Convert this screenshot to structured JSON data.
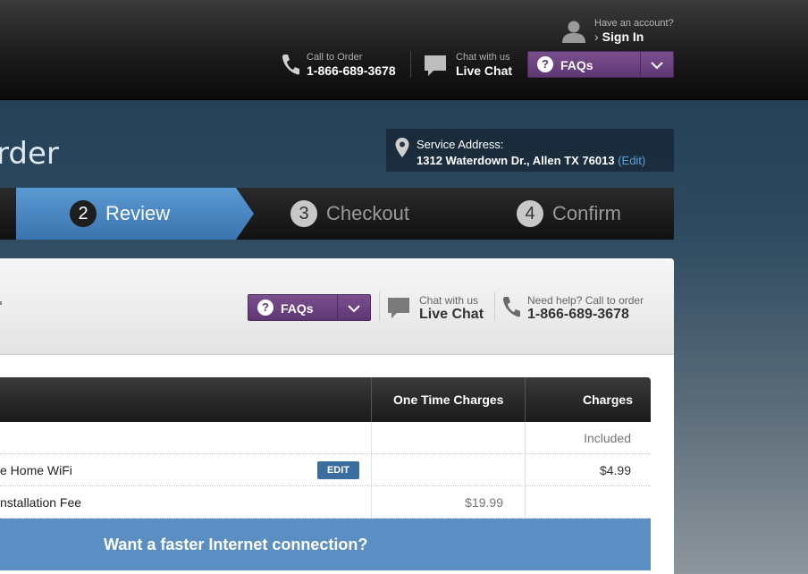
{
  "header": {
    "account": {
      "prompt": "Have an account?",
      "sign_in": "Sign In",
      "icon": "user-silhouette-icon"
    },
    "call": {
      "label": "Call to Order",
      "number": "1-866-689-3678",
      "icon": "phone-icon"
    },
    "chat": {
      "label": "Chat with us",
      "action": "Live Chat",
      "icon": "chat-bubble-icon"
    },
    "faq": {
      "label": "FAQs",
      "icon": "question-icon"
    }
  },
  "hero": {
    "title_fragment": "rder",
    "service_address": {
      "label": "Service Address:",
      "address": "1312 Waterdown Dr., Allen TX 76013",
      "edit": "(Edit)"
    }
  },
  "steps": [
    {
      "number": "2",
      "label": "Review",
      "state": "active"
    },
    {
      "number": "3",
      "label": "Checkout",
      "state": "inactive"
    },
    {
      "number": "4",
      "label": "Confirm",
      "state": "inactive"
    }
  ],
  "help_bar": {
    "faq_label": "FAQs",
    "chat_label": "Chat with us",
    "chat_action": "Live Chat",
    "call_label": "Need help? Call to order",
    "call_number": "1-866-689-3678"
  },
  "order_table": {
    "columns": [
      "One Time Charges",
      "Charges"
    ],
    "rows": [
      {
        "item": "",
        "one_time": "",
        "charges": "Included"
      },
      {
        "item": "e Home WiFi",
        "edit": "EDIT",
        "one_time": "",
        "charges": "$4.99"
      },
      {
        "item": "nstallation Fee",
        "one_time": "$19.99",
        "charges": ""
      }
    ],
    "promo": "Want a faster Internet connection?"
  },
  "colors": {
    "faq_purple": "#6b4380",
    "active_step_blue": "#4a86c0",
    "promo_blue": "#5b8fc4",
    "edit_blue": "#3a6ea0",
    "link_blue": "#5aa3dd"
  }
}
